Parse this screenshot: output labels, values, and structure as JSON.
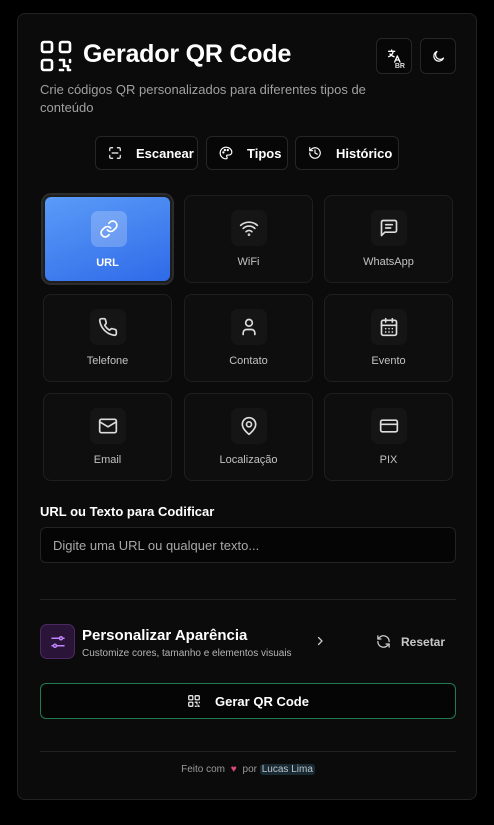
{
  "header": {
    "title": "Gerador QR Code",
    "subtitle": "Crie códigos QR personalizados para diferentes tipos de conteúdo",
    "lang_badge": "BR"
  },
  "actions": [
    {
      "label": "Escanear",
      "icon": "scan-icon"
    },
    {
      "label": "Tipos",
      "icon": "palette-icon"
    },
    {
      "label": "Histórico",
      "icon": "history-icon"
    }
  ],
  "types": [
    {
      "label": "URL",
      "icon": "link-icon",
      "selected": true
    },
    {
      "label": "WiFi",
      "icon": "wifi-icon",
      "selected": false
    },
    {
      "label": "WhatsApp",
      "icon": "message-icon",
      "selected": false
    },
    {
      "label": "Telefone",
      "icon": "phone-icon",
      "selected": false
    },
    {
      "label": "Contato",
      "icon": "user-icon",
      "selected": false
    },
    {
      "label": "Evento",
      "icon": "calendar-icon",
      "selected": false
    },
    {
      "label": "Email",
      "icon": "mail-icon",
      "selected": false
    },
    {
      "label": "Localização",
      "icon": "map-pin-icon",
      "selected": false
    },
    {
      "label": "PIX",
      "icon": "credit-card-icon",
      "selected": false
    }
  ],
  "input": {
    "label": "URL ou Texto para Codificar",
    "placeholder": "Digite uma URL ou qualquer texto...",
    "value": ""
  },
  "customize": {
    "title": "Personalizar Aparência",
    "subtitle": "Customize cores, tamanho e elementos visuais",
    "reset_label": "Resetar"
  },
  "generate": {
    "label": "Gerar QR Code"
  },
  "footer": {
    "prefix": "Feito com",
    "by": "por",
    "author": "Lucas Lima"
  },
  "colors": {
    "accent_blue": "#3b82f6",
    "accent_green": "#1f7a52",
    "purple": "#a855f7",
    "heart": "#e0487a"
  }
}
